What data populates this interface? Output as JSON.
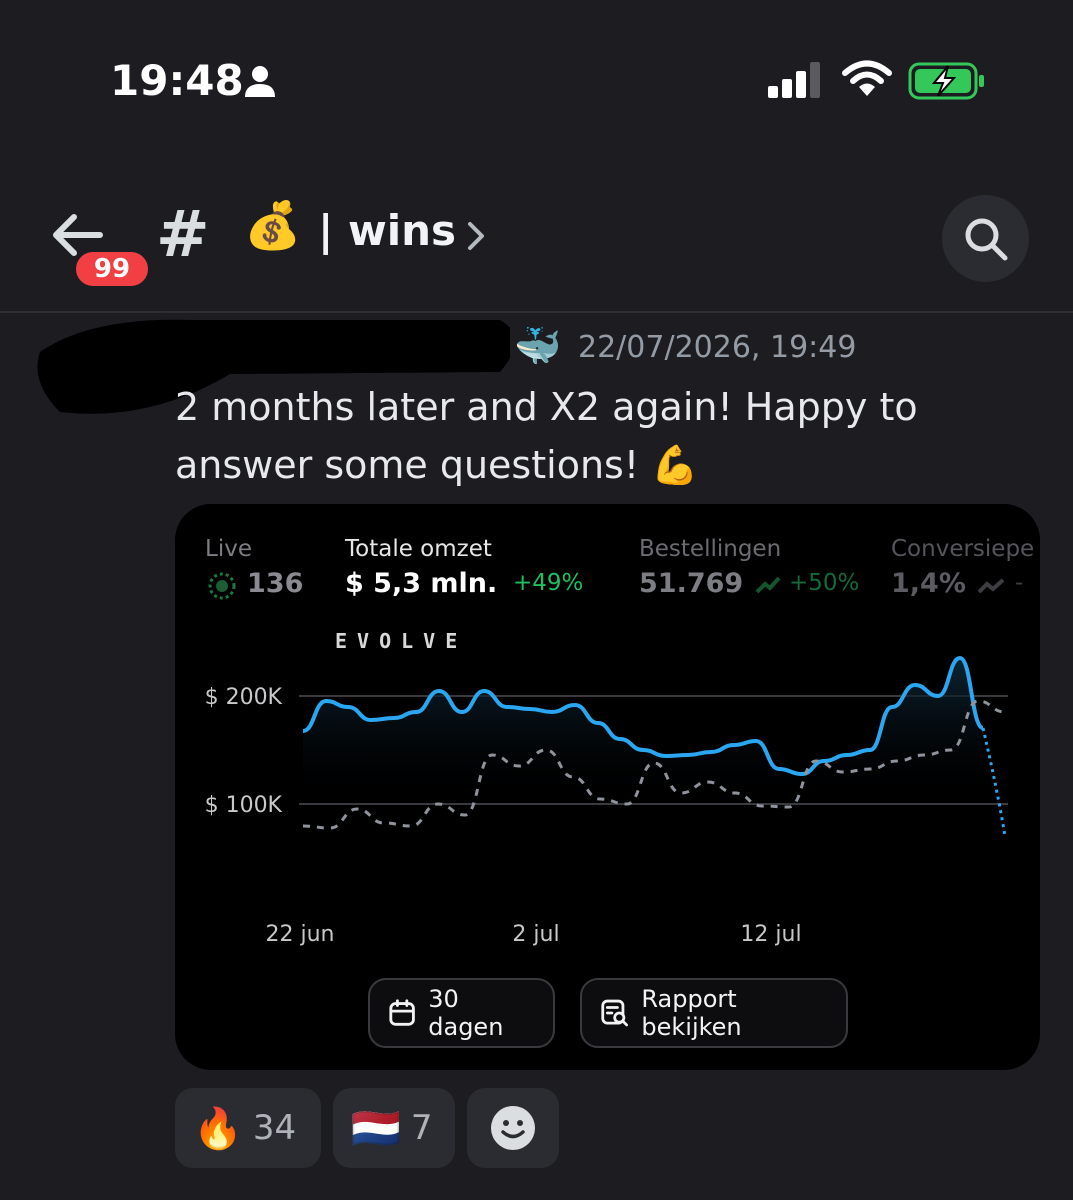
{
  "status_bar": {
    "time": "19:48"
  },
  "header": {
    "badge": "99",
    "hash": "#",
    "channel_emoji": "💰",
    "channel_name": "| wins"
  },
  "message": {
    "user_emoji": "🐳",
    "timestamp": "22/07/2026, 19:49",
    "text": "2 months later and X2 again! Happy to answer some questions! 💪"
  },
  "card": {
    "kpis": [
      {
        "label": "Live",
        "value": "136"
      },
      {
        "label": "Totale omzet",
        "value": "$ 5,3 mln.",
        "change": "+49%"
      },
      {
        "label": "Bestellingen",
        "value": "51.769",
        "change": "+50%"
      },
      {
        "label": "Conversiepe",
        "value": "1,4%",
        "change": "-"
      }
    ],
    "watermark": "EVOLVE",
    "buttons": {
      "period": "30 dagen",
      "report": "Rapport bekijken"
    }
  },
  "chart_data": {
    "type": "line",
    "y_ticks": [
      "$ 200K",
      "$ 100K"
    ],
    "x_ticks": [
      "22 jun",
      "2 jul",
      "12 jul"
    ],
    "ylim": [
      70000,
      270000
    ],
    "series": [
      {
        "style": "solid",
        "color": "#2aa7f0",
        "values": [
          168000,
          195000,
          190000,
          178000,
          180000,
          185000,
          205000,
          185000,
          205000,
          190000,
          188000,
          185000,
          192000,
          175000,
          160000,
          150000,
          144000,
          145000,
          148000,
          155000,
          158000,
          132000,
          128000,
          140000,
          145000,
          150000,
          190000,
          210000,
          200000,
          235000,
          170000,
          70000
        ]
      },
      {
        "style": "dashed",
        "color": "#8f949c",
        "values": [
          80000,
          78000,
          95000,
          82000,
          80000,
          100000,
          90000,
          145000,
          135000,
          150000,
          125000,
          105000,
          100000,
          138000,
          110000,
          120000,
          110000,
          98000,
          97000,
          140000,
          130000,
          132000,
          140000,
          145000,
          150000,
          195000,
          185000
        ]
      }
    ]
  },
  "reactions": [
    {
      "emoji": "🔥",
      "count": "34"
    },
    {
      "emoji": "🇳🇱",
      "count": "7"
    }
  ],
  "colors": {
    "positive": "#1fbf5f",
    "line": "#2aa7f0",
    "badge": "#f23f43"
  }
}
